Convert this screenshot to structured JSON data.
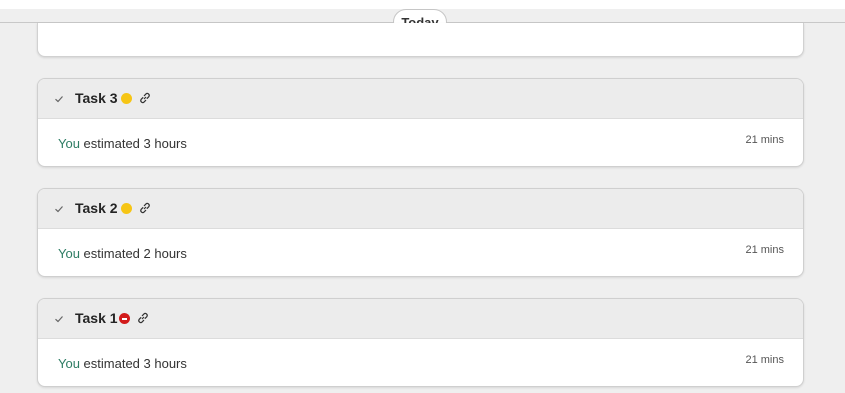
{
  "divider": {
    "label": "Today"
  },
  "tasks": [
    {
      "title": "Task 3",
      "status": "yellow",
      "status_color": "#f6c514",
      "icon": "link-icon",
      "actor": "You",
      "message": " estimated 3 hours",
      "time": "21 mins"
    },
    {
      "title": "Task 2",
      "status": "yellow",
      "status_color": "#f6c514",
      "icon": "link-icon",
      "actor": "You",
      "message": " estimated 2 hours",
      "time": "21 mins"
    },
    {
      "title": "Task 1",
      "status": "red",
      "status_color": "#d21b1b",
      "icon": "link-icon",
      "actor": "You",
      "message": " estimated 3 hours",
      "time": "21 mins"
    }
  ],
  "colors": {
    "actor": "#2e7d64",
    "header_bg": "#ececec",
    "page_bg": "#efefef"
  }
}
